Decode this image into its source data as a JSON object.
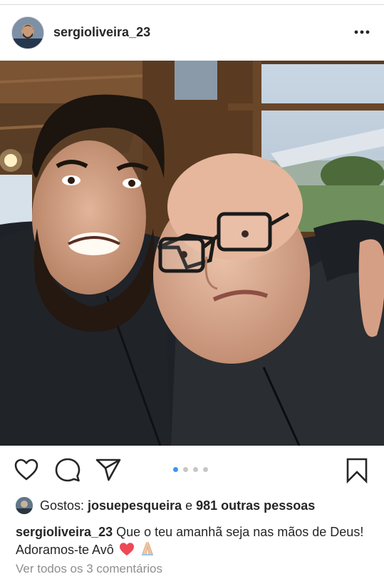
{
  "post": {
    "username": "sergioliveira_23",
    "more_icon": "more-horizontal-icon",
    "photo_alt": "",
    "carousel": {
      "total": 4,
      "active": 0
    },
    "colors": {
      "active_dot": "#3897f0",
      "inactive_dot": "#c7c7c7",
      "heart": "#ed4956"
    }
  },
  "actions": {
    "like_icon": "heart-outline-icon",
    "comment_icon": "comment-icon",
    "share_icon": "direct-share-icon",
    "save_icon": "bookmark-icon"
  },
  "likes": {
    "prefix": "Gostos:",
    "liker": "josuepesqueira",
    "joiner": "e",
    "others": "981 outras pessoas"
  },
  "caption": {
    "username": "sergioliveira_23",
    "text": "Que o teu amanhã seja nas mãos de Deus! Adoramos-te Avô",
    "emojis": [
      "red-heart-emoji",
      "folded-hands-emoji"
    ]
  },
  "comments": {
    "view_all": "Ver todos os 3 comentários"
  }
}
